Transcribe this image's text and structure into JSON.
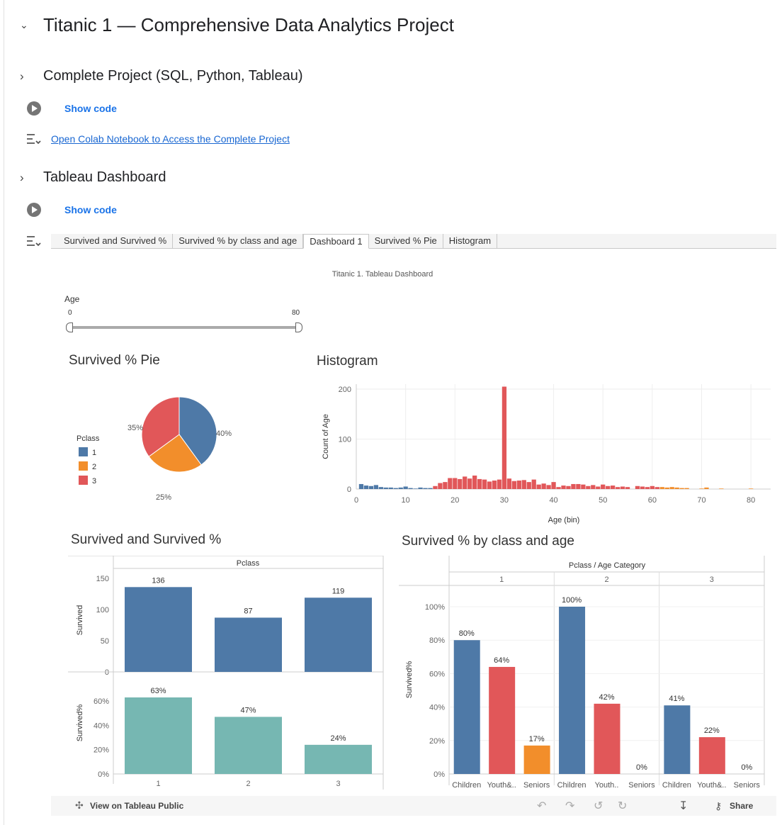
{
  "header": {
    "title": "Titanic 1 — Comprehensive Data Analytics Project"
  },
  "sections": [
    {
      "title": "Complete Project (SQL, Python, Tableau)"
    },
    {
      "title": "Tableau Dashboard"
    }
  ],
  "cells": {
    "show_code": "Show code",
    "colab_link": "Open Colab Notebook to Access the Complete Project"
  },
  "tabs": [
    "Survived and Survived %",
    "Survived % by class and age",
    "Dashboard 1",
    "Survived % Pie",
    "Histogram"
  ],
  "dashboard": {
    "title": "Titanic 1. Tableau Dashboard",
    "age_filter": {
      "label": "Age",
      "min": "0",
      "max": "80"
    }
  },
  "footer": {
    "view": "View on Tableau Public",
    "share": "Share"
  },
  "colors": {
    "blue": "#4e79a7",
    "orange": "#f28e2b",
    "red": "#e15759",
    "teal": "#76b7b2",
    "link": "#1967d2"
  },
  "chart_data": [
    {
      "type": "pie",
      "title": "Survived % Pie",
      "legend_title": "Pclass",
      "labels": [
        "1",
        "2",
        "3"
      ],
      "values": [
        40,
        25,
        35
      ],
      "value_labels": [
        "40%",
        "25%",
        "35%"
      ]
    },
    {
      "type": "bar",
      "title": "Histogram",
      "xlabel": "Age (bin)",
      "ylabel": "Count of Age",
      "xticks": [
        0,
        10,
        20,
        30,
        40,
        50,
        60,
        70,
        80
      ],
      "yticks": [
        0,
        100,
        200
      ],
      "ylim": [
        0,
        210
      ],
      "x": [
        1,
        2,
        3,
        4,
        5,
        6,
        7,
        8,
        9,
        10,
        11,
        12,
        13,
        14,
        15,
        16,
        17,
        18,
        19,
        20,
        21,
        22,
        23,
        24,
        25,
        26,
        27,
        28,
        29,
        30,
        31,
        32,
        33,
        34,
        35,
        36,
        37,
        38,
        39,
        40,
        41,
        42,
        43,
        44,
        45,
        46,
        47,
        48,
        49,
        50,
        51,
        52,
        53,
        54,
        55,
        56,
        57,
        58,
        59,
        60,
        61,
        62,
        63,
        64,
        65,
        66,
        67,
        70,
        71,
        74,
        80
      ],
      "values": [
        10,
        7,
        6,
        8,
        4,
        3,
        3,
        2,
        3,
        5,
        2,
        1,
        3,
        2,
        2,
        6,
        12,
        14,
        22,
        22,
        20,
        25,
        21,
        27,
        20,
        19,
        15,
        17,
        19,
        205,
        21,
        16,
        17,
        18,
        14,
        19,
        9,
        11,
        8,
        14,
        4,
        7,
        6,
        10,
        10,
        9,
        6,
        8,
        5,
        9,
        6,
        7,
        4,
        5,
        4,
        0,
        6,
        5,
        4,
        6,
        4,
        4,
        3,
        4,
        3,
        2,
        2,
        1,
        3,
        1,
        1
      ]
    },
    {
      "type": "bar",
      "title": "Survived and Survived %",
      "header": "Pclass",
      "categories": [
        "1",
        "2",
        "3"
      ],
      "series": [
        {
          "name": "Survived",
          "values": [
            136,
            87,
            119
          ],
          "yticks": [
            0,
            50,
            100,
            150
          ]
        },
        {
          "name": "Survived%",
          "values": [
            63,
            47,
            24
          ],
          "labels": [
            "63%",
            "47%",
            "24%"
          ],
          "yticks": [
            "0%",
            "20%",
            "40%",
            "60%"
          ]
        }
      ]
    },
    {
      "type": "bar",
      "title": "Survived % by class and age",
      "header": "Pclass / Age Category",
      "ylabel": "Survived%",
      "groups": [
        "1",
        "2",
        "3"
      ],
      "categories": [
        "Children",
        "Youth&..",
        "Seniors",
        "Children",
        "Youth..",
        "Seniors",
        "Children",
        "Youth&..",
        "Seniors"
      ],
      "values": [
        80,
        64,
        17,
        100,
        42,
        0,
        41,
        22,
        0
      ],
      "labels": [
        "80%",
        "64%",
        "17%",
        "100%",
        "42%",
        "0%",
        "41%",
        "22%",
        "0%"
      ],
      "yticks": [
        "0%",
        "20%",
        "40%",
        "60%",
        "80%",
        "100%"
      ]
    }
  ]
}
